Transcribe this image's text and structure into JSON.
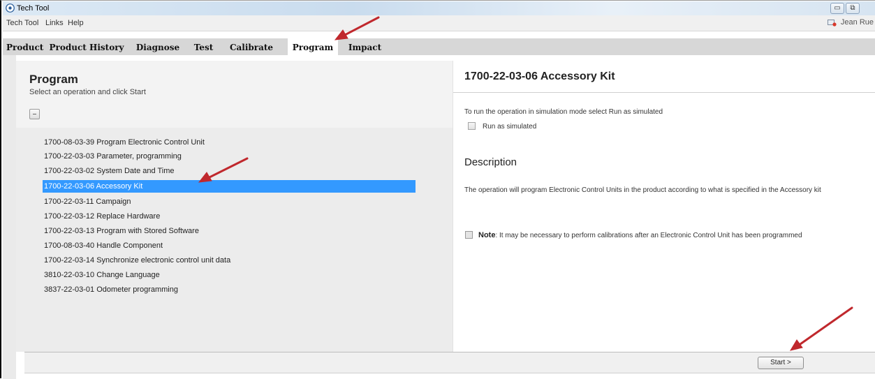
{
  "window": {
    "title": "Tech Tool",
    "controls": [
      "minimize",
      "restore"
    ]
  },
  "menu": {
    "items": [
      "Tech Tool",
      "Links",
      "Help"
    ],
    "user_name": "Jean Rue"
  },
  "tabs": [
    {
      "label": "Product",
      "active": false
    },
    {
      "label": "Product History",
      "active": false
    },
    {
      "label": "Diagnose",
      "active": false
    },
    {
      "label": "Test",
      "active": false
    },
    {
      "label": "Calibrate",
      "active": false
    },
    {
      "label": "Program",
      "active": true
    },
    {
      "label": "Impact",
      "active": false
    }
  ],
  "program": {
    "title": "Program",
    "subtitle": "Select an operation and click Start",
    "operations": [
      {
        "label": "1700-08-03-39 Program Electronic Control Unit",
        "selected": false
      },
      {
        "label": "1700-22-03-03 Parameter, programming",
        "selected": false
      },
      {
        "label": "1700-22-03-02 System Date and Time",
        "selected": false
      },
      {
        "label": "1700-22-03-06 Accessory Kit",
        "selected": true
      },
      {
        "label": "1700-22-03-11 Campaign",
        "selected": false
      },
      {
        "label": "1700-22-03-12 Replace Hardware",
        "selected": false
      },
      {
        "label": "1700-22-03-13 Program with Stored Software",
        "selected": false
      },
      {
        "label": "1700-08-03-40 Handle Component",
        "selected": false
      },
      {
        "label": "1700-22-03-14 Synchronize electronic control unit data",
        "selected": false
      },
      {
        "label": "3810-22-03-10 Change Language",
        "selected": false
      },
      {
        "label": "3837-22-03-01 Odometer programming",
        "selected": false
      }
    ]
  },
  "detail": {
    "title": "1700-22-03-06 Accessory Kit",
    "simulation_text": "To run the operation in simulation mode select Run as simulated",
    "simulation_checkbox_label": "Run as simulated",
    "simulation_checked": false,
    "description_heading": "Description",
    "description_text": "The operation will program Electronic Control Units in the product according to what is specified in the Accessory kit",
    "note_label": "Note",
    "note_text": ": It may be necessary to perform calibrations after an Electronic Control Unit has been programmed"
  },
  "footer": {
    "start_label": "Start >"
  },
  "colors": {
    "selection": "#3399ff",
    "tab_bar": "#d7d7d7",
    "annotation_arrow": "#c0282d"
  }
}
